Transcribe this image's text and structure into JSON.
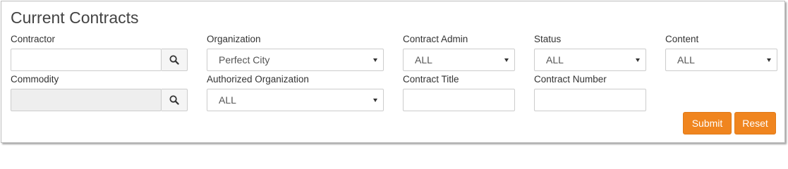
{
  "page": {
    "title": "Current Contracts"
  },
  "fields": {
    "contractor": {
      "label": "Contractor",
      "value": ""
    },
    "organization": {
      "label": "Organization",
      "selected": "Perfect City"
    },
    "contract_admin": {
      "label": "Contract Admin",
      "selected": "ALL"
    },
    "status": {
      "label": "Status",
      "selected": "ALL"
    },
    "content": {
      "label": "Content",
      "selected": "ALL"
    },
    "commodity": {
      "label": "Commodity",
      "value": ""
    },
    "authorized_organization": {
      "label": "Authorized Organization",
      "selected": "ALL"
    },
    "contract_title": {
      "label": "Contract Title",
      "value": ""
    },
    "contract_number": {
      "label": "Contract Number",
      "value": ""
    }
  },
  "actions": {
    "submit_label": "Submit",
    "reset_label": "Reset"
  },
  "icons": {
    "search": "search-icon",
    "dropdown": "chevron-down-icon"
  },
  "colors": {
    "primary_button": "#f0851f",
    "disabled_input": "#eeeeee",
    "border": "#cccccc"
  }
}
